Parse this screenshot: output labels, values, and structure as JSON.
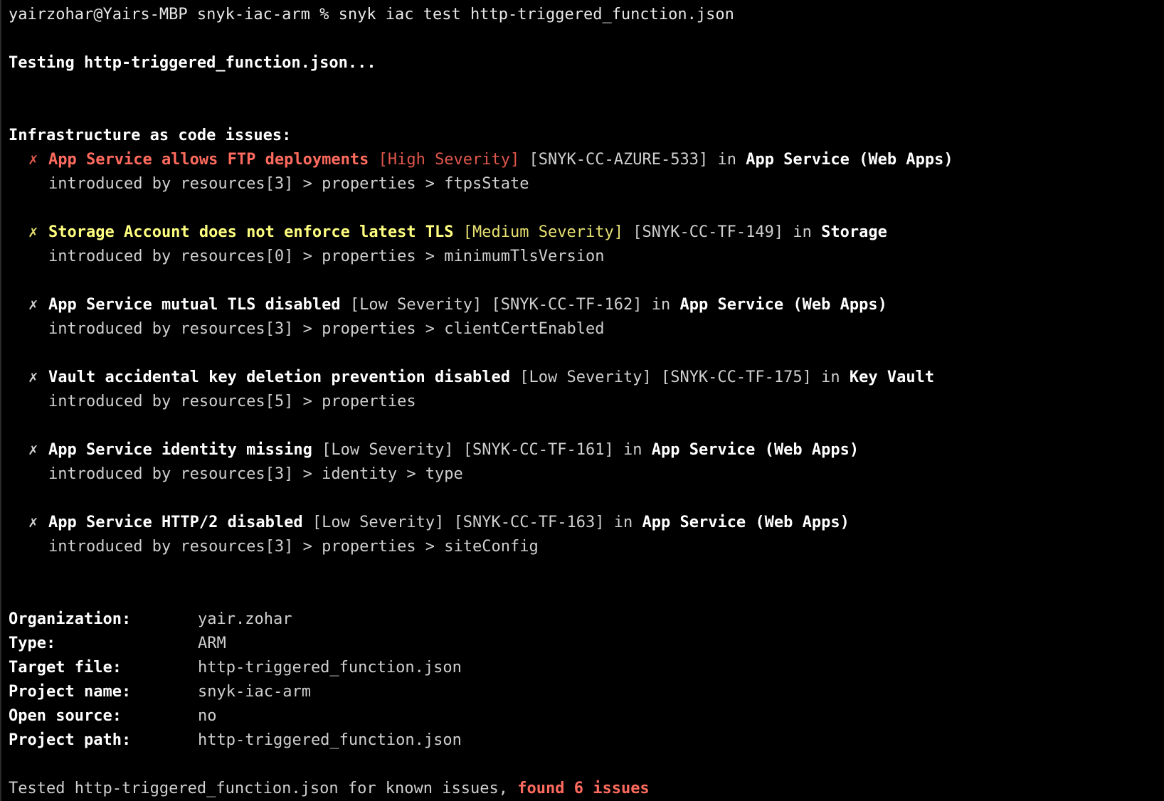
{
  "prompt_line": "yairzohar@Yairs-MBP snyk-iac-arm % snyk iac test http-triggered_function.json",
  "testing_line": "Testing http-triggered_function.json...",
  "issues_header": "Infrastructure as code issues:",
  "colors": {
    "high": "#ff6b5e",
    "medium": "#ffff80",
    "low": "#ffffff",
    "background": "#000000"
  },
  "issues": [
    {
      "mark": "✗",
      "title": "App Service allows FTP deployments",
      "severity": "[High Severity]",
      "id": "[SNYK-CC-AZURE-533]",
      "in_word": "in",
      "service": "App Service (Web Apps)",
      "path": "introduced by resources[3] > properties > ftpsState"
    },
    {
      "mark": "✗",
      "title": "Storage Account does not enforce latest TLS",
      "severity": "[Medium Severity]",
      "id": "[SNYK-CC-TF-149]",
      "in_word": "in",
      "service": "Storage",
      "path": "introduced by resources[0] > properties > minimumTlsVersion"
    },
    {
      "mark": "✗",
      "title": "App Service mutual TLS disabled",
      "severity": "[Low Severity]",
      "id": "[SNYK-CC-TF-162]",
      "in_word": "in",
      "service": "App Service (Web Apps)",
      "path": "introduced by resources[3] > properties > clientCertEnabled"
    },
    {
      "mark": "✗",
      "title": "Vault accidental key deletion prevention disabled",
      "severity": "[Low Severity]",
      "id": "[SNYK-CC-TF-175]",
      "in_word": "in",
      "service": "Key Vault",
      "path": "introduced by resources[5] > properties"
    },
    {
      "mark": "✗",
      "title": "App Service identity missing",
      "severity": "[Low Severity]",
      "id": "[SNYK-CC-TF-161]",
      "in_word": "in",
      "service": "App Service (Web Apps)",
      "path": "introduced by resources[3] > identity > type"
    },
    {
      "mark": "✗",
      "title": "App Service HTTP/2 disabled",
      "severity": "[Low Severity]",
      "id": "[SNYK-CC-TF-163]",
      "in_word": "in",
      "service": "App Service (Web Apps)",
      "path": "introduced by resources[3] > properties > siteConfig"
    }
  ],
  "summary": [
    {
      "label": "Organization:",
      "value": "yair.zohar"
    },
    {
      "label": "Type:",
      "value": "ARM"
    },
    {
      "label": "Target file:",
      "value": "http-triggered_function.json"
    },
    {
      "label": "Project name:",
      "value": "snyk-iac-arm"
    },
    {
      "label": "Open source:",
      "value": "no"
    },
    {
      "label": "Project path:",
      "value": "http-triggered_function.json"
    }
  ],
  "footer": {
    "prefix": "Tested http-triggered_function.json for known issues, ",
    "found": "found 6 issues"
  }
}
